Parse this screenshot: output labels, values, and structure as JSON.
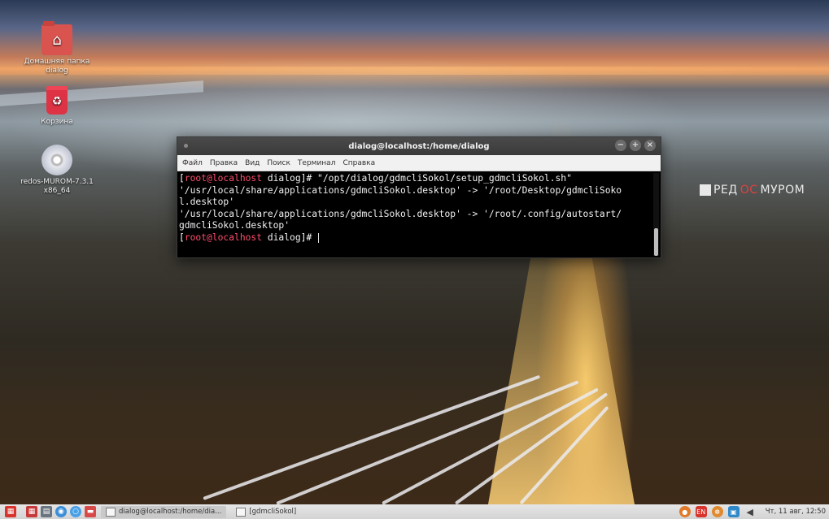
{
  "desktop": {
    "icons": [
      {
        "label": "Домашняя папка dialog"
      },
      {
        "label": "Корзина"
      },
      {
        "label": "redos-MUROM-7.3.1 x86_64"
      }
    ],
    "brand": {
      "part1": "РЕД",
      "part2": "ОС",
      "part3": "МУРОМ"
    }
  },
  "terminal": {
    "title": "dialog@localhost:/home/dialog",
    "menu": [
      "Файл",
      "Правка",
      "Вид",
      "Поиск",
      "Терминал",
      "Справка"
    ],
    "prompt_user": "root@localhost",
    "prompt_dir": " dialog",
    "command": " \"/opt/dialog/gdmcliSokol/setup_gdmcliSokol.sh\"",
    "output_lines": [
      "'/usr/local/share/applications/gdmcliSokol.desktop' -> '/root/Desktop/gdmcliSoko",
      "l.desktop'",
      "'/usr/local/share/applications/gdmcliSokol.desktop' -> '/root/.config/autostart/",
      "gdmcliSokol.desktop'"
    ]
  },
  "taskbar": {
    "tasks": [
      {
        "label": "dialog@localhost:/home/dia...",
        "active": true
      },
      {
        "label": "[gdmcliSokol]",
        "active": false
      }
    ],
    "keyboard_layout": "EN",
    "clock": "Чт, 11 авг, 12:50"
  }
}
